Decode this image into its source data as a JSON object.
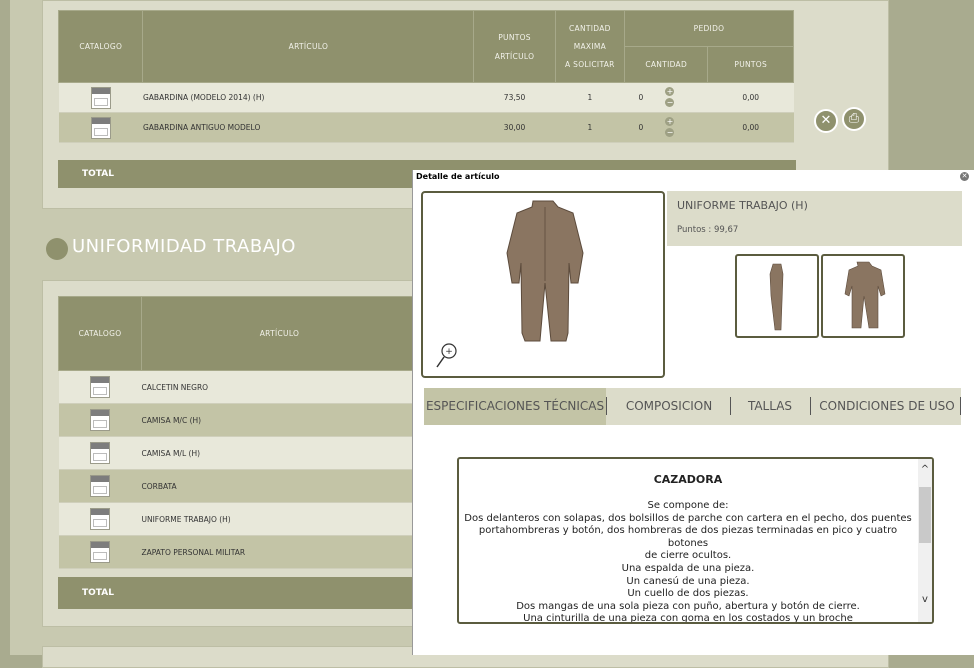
{
  "table1": {
    "headers": {
      "catalogo": "CATALOGO",
      "articulo": "ARTÍCULO",
      "puntos_articulo": [
        "PUNTOS",
        "ARTÍCULO"
      ],
      "cantidad_maxima": [
        "CANTIDAD",
        "MAXIMA",
        "A SOLICITAR"
      ],
      "pedido": "PEDIDO",
      "cantidad": "CANTIDAD",
      "puntos": "PUNTOS"
    },
    "rows": [
      {
        "articulo": "GABARDINA (MODELO 2014) (H)",
        "puntos": "73,50",
        "max": "1",
        "cantidad": "0",
        "pedido_puntos": "0,00"
      },
      {
        "articulo": "GABARDINA ANTIGUO MODELO",
        "puntos": "30,00",
        "max": "1",
        "cantidad": "0",
        "pedido_puntos": "0,00"
      }
    ],
    "total_label": "TOTAL"
  },
  "section2": {
    "title": "UNIFORMIDAD TRABAJO"
  },
  "table2": {
    "headers": {
      "catalogo": "CATALOGO",
      "articulo": "ARTÍCULO"
    },
    "rows": [
      {
        "articulo": "CALCETIN NEGRO"
      },
      {
        "articulo": "CAMISA M/C (H)"
      },
      {
        "articulo": "CAMISA M/L (H)"
      },
      {
        "articulo": "CORBATA"
      },
      {
        "articulo": "UNIFORME TRABAJO (H)"
      },
      {
        "articulo": "ZAPATO PERSONAL MILITAR"
      }
    ],
    "total_label": "TOTAL"
  },
  "modal": {
    "title": "Detalle de artículo",
    "product_name": "UNIFORME TRABAJO (H)",
    "puntos_label": "Puntos : 99,67",
    "tabs": [
      "ESPECIFICACIONES TÉCNICAS",
      "COMPOSICION",
      "TALLAS",
      "CONDICIONES DE USO"
    ],
    "desc_title": "CAZADORA",
    "desc_lines": [
      "Se compone de:",
      "Dos delanteros con solapas, dos bolsillos de parche con cartera en el pecho, dos puentes",
      "portahombreras y botón, dos hombreras de dos piezas terminadas en pico y cuatro botones",
      "de cierre ocultos.",
      "Una espalda de una pieza.",
      "Un canesú de una pieza.",
      "Un cuello de dos piezas.",
      "Dos mangas de una sola pieza con puño, abertura y botón de cierre.",
      "Una cinturilla de una pieza con goma en los costados y un broche"
    ]
  },
  "icons": {
    "close": "close-icon",
    "print": "print-icon",
    "zoom": "zoom-icon",
    "hanger": "hanger-icon"
  },
  "colors": {
    "header": "#8f916d",
    "panel": "#c8c9b0",
    "row_dark": "#c3c4a6",
    "border_dark": "#5b5c3f",
    "garment": "#8a7561"
  }
}
